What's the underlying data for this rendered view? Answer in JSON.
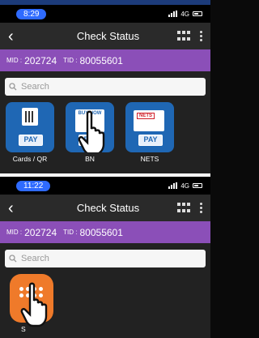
{
  "screen1": {
    "status": {
      "time": "8:29",
      "network": "4G"
    },
    "appbar": {
      "title": "Check Status"
    },
    "merchant": {
      "mid_label": "MID :",
      "mid": "202724",
      "tid_label": "TID :",
      "tid": "80055601"
    },
    "search": {
      "placeholder": "Search"
    },
    "tiles": [
      {
        "label": "Cards / QR",
        "badge": "PAY"
      },
      {
        "label": "BN",
        "caption": "BUY NOW",
        "badge": "PAY"
      },
      {
        "label": "NETS",
        "logo": "NETS",
        "badge": "PAY"
      }
    ]
  },
  "screen2": {
    "status": {
      "time": "11:22",
      "network": "4G"
    },
    "appbar": {
      "title": "Check Status"
    },
    "merchant": {
      "mid_label": "MID :",
      "mid": "202724",
      "tid_label": "TID :",
      "tid": "80055601"
    },
    "search": {
      "placeholder": "Search"
    },
    "tiles": [
      {
        "label": "S"
      }
    ]
  },
  "colors": {
    "status_pill": "#2f6bff",
    "merchant_bar": "#8b4fb8",
    "tile_blue": "#1f67b4",
    "tile_orange": "#ef7a2a"
  },
  "icons": [
    "back-arrow-icon",
    "grid-icon",
    "kebab-menu-icon",
    "search-icon",
    "pointing-hand-icon",
    "signal-icon",
    "battery-icon"
  ]
}
